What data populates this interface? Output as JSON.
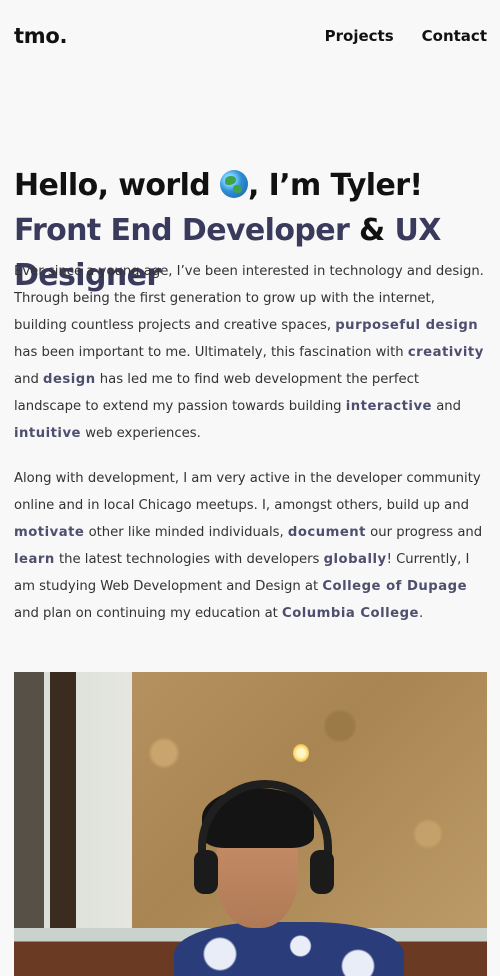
{
  "header": {
    "logo": "tmo.",
    "nav": [
      "Projects",
      "Contact"
    ]
  },
  "hero": {
    "greeting_part1": "Hello, world",
    "greeting_part2": ", I’m Tyler!",
    "role_part1": "Front End Developer",
    "ampersand": "&",
    "role_part2": "UX Designer",
    "globe_icon": "globe-emoji"
  },
  "about": {
    "p1": [
      "Ever since a young age, I’ve been interested in technology and design. Through being the first generation to grow up with the internet, building countless projects and creative spaces, ",
      {
        "strong": "purposeful design"
      },
      " has been important to me. Ultimately, this fascination with ",
      {
        "strong": "creativity"
      },
      " and ",
      {
        "strong": "design"
      },
      " has led me to find web development the perfect landscape to extend my passion towards building ",
      {
        "strong": "interactive"
      },
      " and ",
      {
        "strong": "intuitive"
      },
      " web experiences."
    ],
    "p2": [
      "Along with development, I am very active in the developer community online and in local Chicago meetups. I, amongst others, build up and ",
      {
        "strong": "motivate"
      },
      " other like minded individuals, ",
      {
        "strong": "document"
      },
      " our progress and ",
      {
        "strong": "learn"
      },
      " the latest technologies with developers ",
      {
        "strong": "globally"
      },
      "! Currently, I am studying Web Development and Design at ",
      {
        "strong": "College of Dupage"
      },
      " and plan on continuing my education at ",
      {
        "strong": "Columbia College"
      },
      "."
    ]
  },
  "colors": {
    "accent": "#3a3a5c",
    "strong_text": "#4e4e6e",
    "background": "#f8f8f9"
  }
}
